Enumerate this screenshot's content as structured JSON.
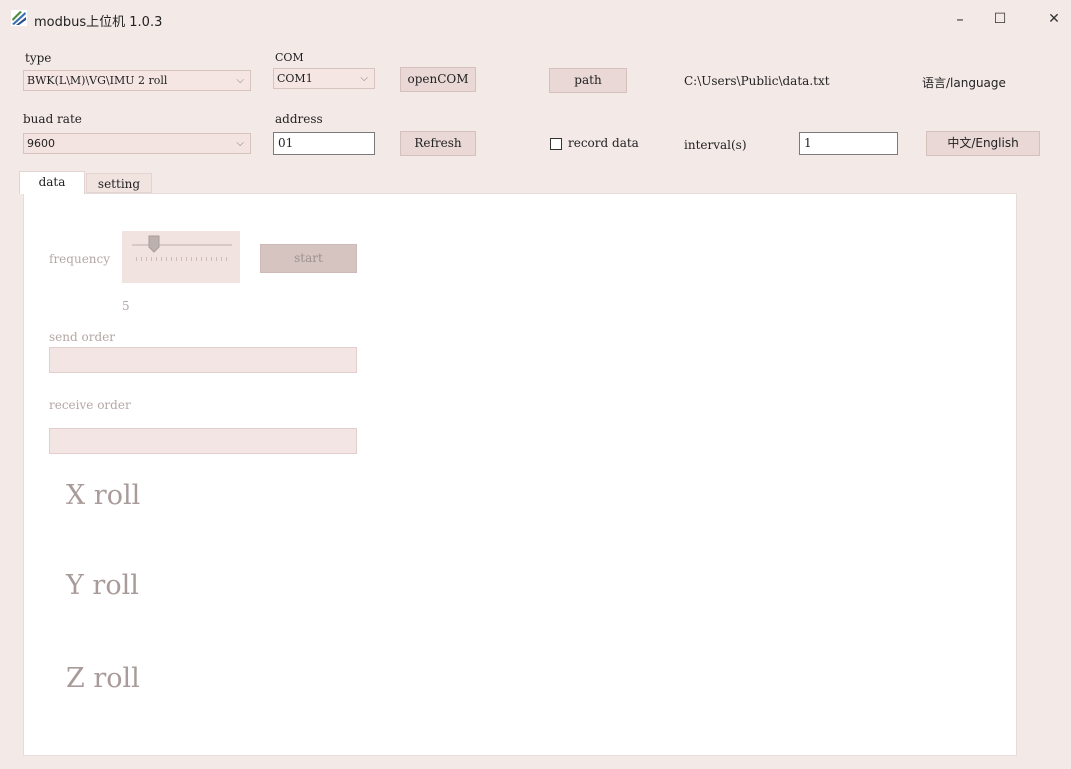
{
  "window": {
    "title": "modbus上位机  1.0.3",
    "minimize_glyph": "–",
    "maximize_glyph": "☐",
    "close_glyph": "✕"
  },
  "connection": {
    "type_label": "type",
    "type_value": "BWK(L\\M)\\VG\\IMU 2 roll",
    "com_label": "COM",
    "com_value": "COM1",
    "open_com_label": "openCOM",
    "baud_label": "buad rate",
    "baud_value": "9600",
    "address_label": "address",
    "address_value": "01",
    "refresh_label": "Refresh"
  },
  "logging": {
    "path_label": "path",
    "path_value": "C:\\Users\\Public\\data.txt",
    "record_label": "record data",
    "record_checked": false,
    "interval_label": "interval(s)",
    "interval_value": "1"
  },
  "language": {
    "label": "语言/language",
    "button_label": "中文/English"
  },
  "tabs": [
    {
      "label": "data",
      "active": true
    },
    {
      "label": "setting",
      "active": false
    }
  ],
  "data_panel": {
    "frequency_label": "frequency",
    "frequency_value": "5",
    "start_label": "start",
    "send_order_label": "send order",
    "send_order_value": "",
    "receive_order_label": "receive order",
    "receive_order_value": "",
    "x_roll": "X roll",
    "y_roll": "Y roll",
    "z_roll": "Z roll"
  }
}
